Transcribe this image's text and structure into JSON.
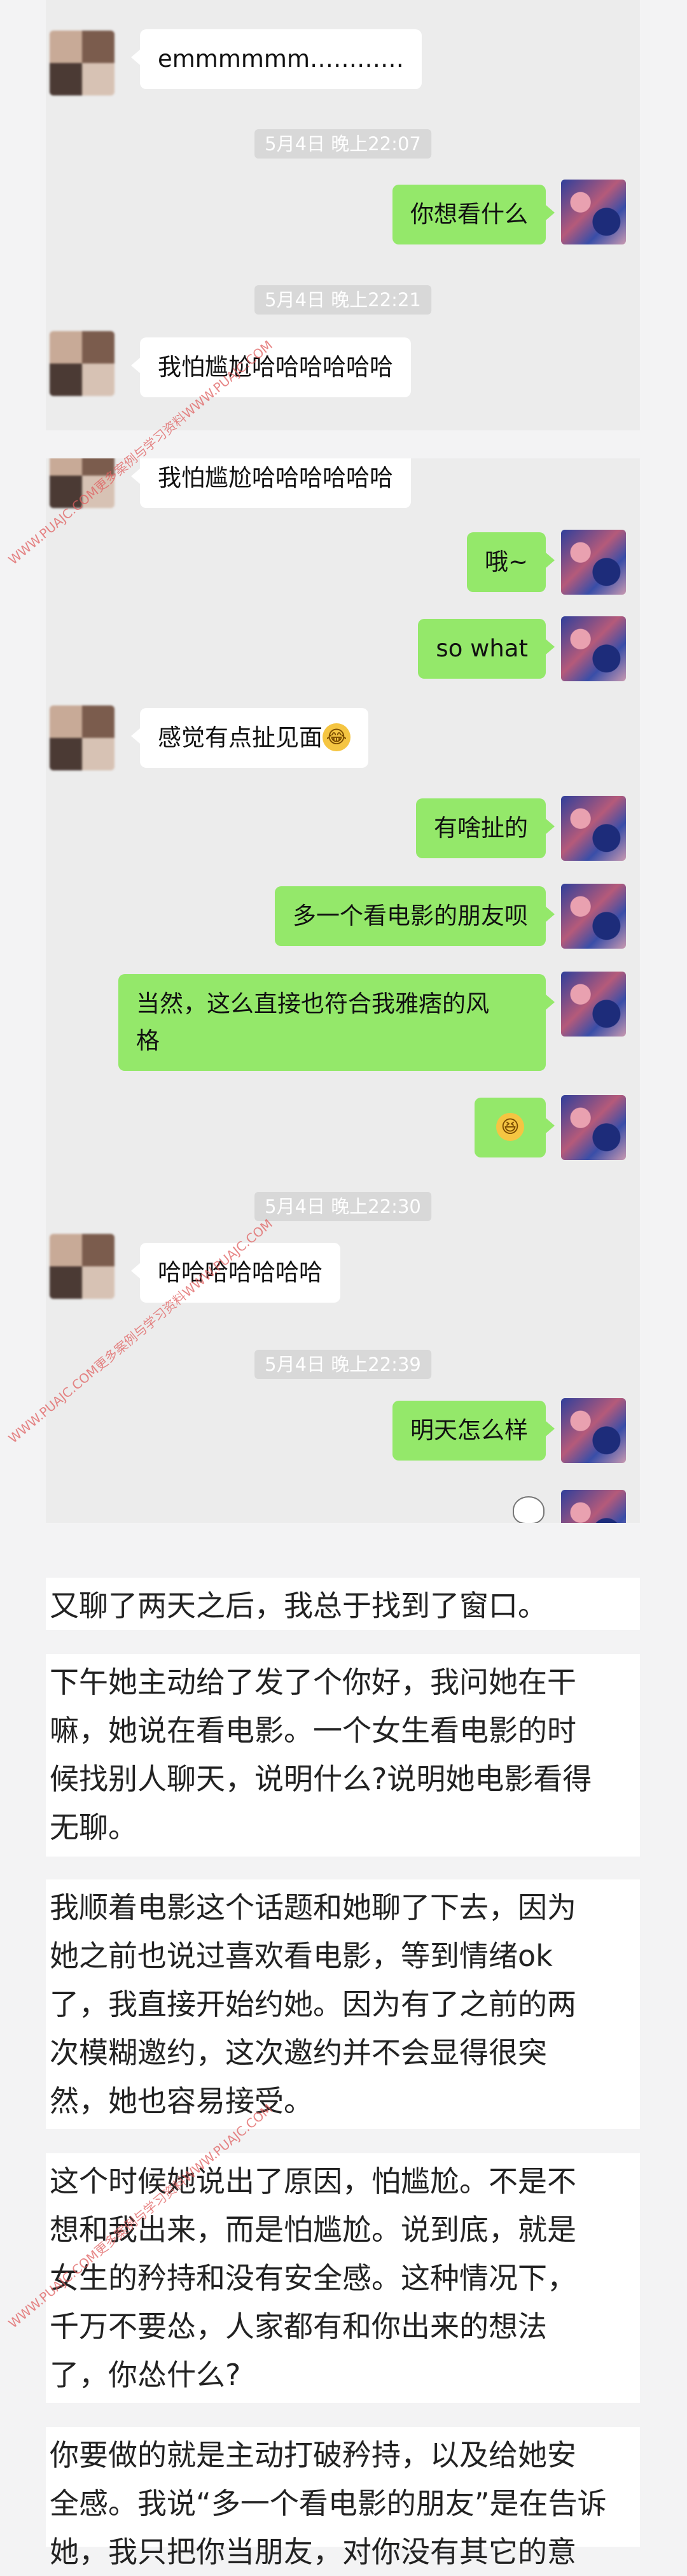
{
  "chat_top": {
    "messages": [
      {
        "side": "left",
        "text": "emmmmmm…………"
      },
      {
        "timestamp": "5月4日 晚上22:07"
      },
      {
        "side": "right",
        "text": "你想看什么"
      },
      {
        "timestamp": "5月4日 晚上22:21"
      },
      {
        "side": "left",
        "text": "我怕尴尬哈哈哈哈哈哈"
      }
    ]
  },
  "chat_bottom": {
    "messages": [
      {
        "side": "left",
        "text": "我怕尴尬哈哈哈哈哈哈"
      },
      {
        "side": "right",
        "text": "哦~"
      },
      {
        "side": "right",
        "text": "so what"
      },
      {
        "side": "left",
        "text": "感觉有点扯见面"
      },
      {
        "side": "right",
        "text": "有啥扯的"
      },
      {
        "side": "right",
        "text": "多一个看电影的朋友呗"
      },
      {
        "side": "right",
        "text_line1": "当然，这么直接也符合我雅痞的风",
        "text_line2": "格"
      },
      {
        "side": "right",
        "text": "emoji"
      },
      {
        "timestamp": "5月4日 晚上22:30"
      },
      {
        "side": "left",
        "text": "哈哈哈哈哈哈哈"
      },
      {
        "timestamp": "5月4日 晚上22:39"
      },
      {
        "side": "right",
        "text": "明天怎么样"
      }
    ]
  },
  "icons": {
    "laugh_emoji": "😂",
    "grin_emoji": "😆"
  },
  "watermark": "WWW.PUAJC.COM更多案例与学习资料WWW.PUAJC.COM",
  "article": {
    "p1": "又聊了两天之后，我总于找到了窗口。",
    "p2_lines": [
      "下午她主动给了发了个你好，我问她在干",
      "嘛，她说在看电影。一个女生看电影的时",
      "候找别人聊天，说明什么?说明她电影看得",
      "无聊。"
    ],
    "p3_lines": [
      "我顺着电影这个话题和她聊了下去，因为",
      "她之前也说过喜欢看电影，等到情绪ok",
      "了，我直接开始约她。因为有了之前的两",
      "次模糊邀约，这次邀约并不会显得很突",
      "然，她也容易接受。"
    ],
    "p4_lines": [
      "这个时候她说出了原因，怕尴尬。不是不",
      "想和我出来，而是怕尴尬。说到底，就是",
      "女生的矜持和没有安全感。这种情况下，",
      "千万不要怂，人家都有和你出来的想法",
      "了，你怂什么?"
    ],
    "p5_lines": [
      "你要做的就是主动打破矜持，以及给她安",
      "全感。我说“多一个看电影的朋友”是在告诉",
      "她，我只把你当朋友，对你没有其它的意"
    ]
  },
  "colors": {
    "bubble_right": "#94e86a",
    "bubble_left": "#ffffff",
    "chat_bg": "#ececec",
    "timestamp_bg": "#d8d8d8",
    "watermark": "#e06060"
  }
}
